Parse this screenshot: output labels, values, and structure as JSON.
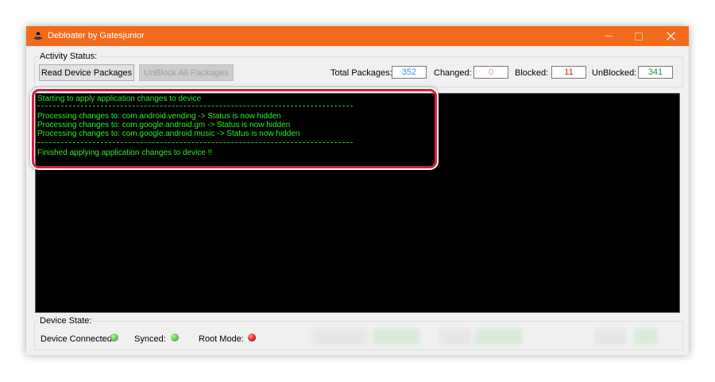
{
  "window": {
    "title": "Debloater by Gatesjunior",
    "icon": "hat-icon",
    "controls": [
      "minimize-icon",
      "maximize-icon",
      "close-icon"
    ]
  },
  "activity": {
    "legend": "Activity Status:",
    "read_button": "Read Device Packages",
    "unblock_button": "UnBlock All Packages",
    "unblock_disabled": true
  },
  "stats": {
    "total_label": "Total Packages:",
    "total_value": "352",
    "changed_label": "Changed:",
    "changed_value": "0",
    "blocked_label": "Blocked:",
    "blocked_value": "11",
    "unblocked_label": "UnBlocked:",
    "unblocked_value": "341"
  },
  "colors": {
    "titlebar": "#f26b1d",
    "console_bg": "#000000",
    "console_text": "#2dee2d",
    "highlight": "#d81f3c",
    "total": "#3a8fd6",
    "changed": "#e08ad8",
    "blocked": "#d42020",
    "unblocked": "#1f8f3f",
    "led_green": "#5cc043",
    "led_red": "#e8131a"
  },
  "console": {
    "lines": [
      "Starting to apply application changes to device",
      "Processing changes to:  com.android.vending  -> Status is now hidden",
      "Processing changes to:  com.google.android.gm  -> Status is now hidden",
      "Processing changes to:  com.google.android.music  -> Status is now hidden",
      "Finished applying application changes to device !!"
    ]
  },
  "device_state": {
    "legend": "Device State:",
    "connected_label": "Device Connected:",
    "connected_icon": "status-led-green-icon",
    "synced_label": "Synced:",
    "synced_icon": "status-led-green-icon",
    "root_label": "Root Mode:",
    "root_icon": "status-led-red-icon"
  }
}
